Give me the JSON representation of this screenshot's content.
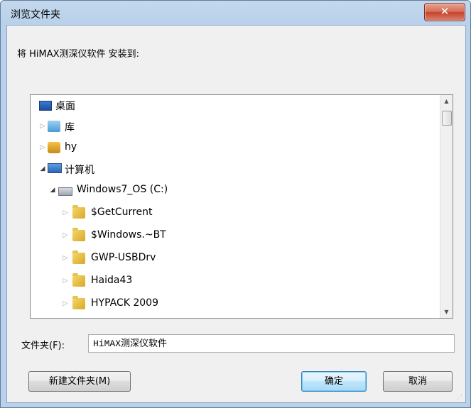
{
  "window": {
    "title": "浏览文件夹",
    "close_glyph": "✕"
  },
  "prompt": "将 HiMAX测深仪软件 安装到:",
  "tree": {
    "items": [
      {
        "label": "桌面",
        "icon": "desktop-icon",
        "arrow": ""
      },
      {
        "label": "库",
        "icon": "library-icon",
        "arrow": "▷"
      },
      {
        "label": "hy",
        "icon": "user-folder-icon",
        "arrow": "▷"
      },
      {
        "label": "计算机",
        "icon": "computer-icon",
        "arrow": "◢"
      },
      {
        "label": "Windows7_OS (C:)",
        "icon": "drive-icon",
        "arrow": "◢"
      },
      {
        "label": "$GetCurrent",
        "icon": "folder-icon",
        "arrow": "▷"
      },
      {
        "label": "$Windows.~BT",
        "icon": "folder-icon",
        "arrow": "▷"
      },
      {
        "label": "GWP-USBDrv",
        "icon": "folder-icon",
        "arrow": "▷"
      },
      {
        "label": "Haida43",
        "icon": "folder-icon",
        "arrow": "▷"
      },
      {
        "label": "HYPACK 2009",
        "icon": "folder-icon",
        "arrow": "▷"
      }
    ],
    "scroll_up": "▲",
    "scroll_down": "▼"
  },
  "folder": {
    "label": "文件夹(F):",
    "value": "HiMAX测深仪软件"
  },
  "buttons": {
    "new_folder": "新建文件夹(M)",
    "ok": "确定",
    "cancel": "取消"
  }
}
